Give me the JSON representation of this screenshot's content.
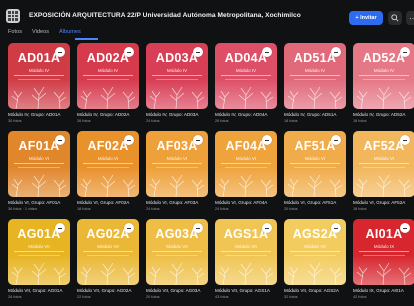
{
  "header": {
    "title": "EXPOSICIÓN ARQUITECTURA 22/P Universidad Autónoma Metropolitana, Xochimilco",
    "invite_label": "+ Invitar",
    "search_icon": "search-icon"
  },
  "tabs": [
    {
      "label": "Fotos"
    },
    {
      "label": "Videos"
    },
    {
      "label": "Álbumes",
      "active": true
    }
  ],
  "colors": {
    "accent": "#2d6cf0",
    "row1": [
      "#cf3c46",
      "#d63a4d",
      "#d83e55",
      "#dd4f66",
      "#e0697a",
      "#e57886"
    ],
    "row2": [
      "#e0872c",
      "#e9912b",
      "#eea03a",
      "#eea33c",
      "#f0ac4a",
      "#f2b75d"
    ],
    "row3": [
      "#e7b423",
      "#eab836",
      "#eebe46",
      "#f0c553",
      "#f3cc60",
      "#d7262d"
    ]
  },
  "albums": [
    {
      "code": "AD01A",
      "sub": "Módulo IV",
      "caption": "Módulo IV, Grupo: AD01A",
      "meta": "30 fotos"
    },
    {
      "code": "AD02A",
      "sub": "Módulo IV",
      "caption": "Módulo IV, Grupo: AD02A",
      "meta": "26 fotos"
    },
    {
      "code": "AD03A",
      "sub": "Módulo IV",
      "caption": "Módulo IV, Grupo: AD03A",
      "meta": "24 fotos"
    },
    {
      "code": "AD04A",
      "sub": "Módulo IV",
      "caption": "Módulo IV, Grupo: AD04A",
      "meta": "26 fotos"
    },
    {
      "code": "AD51A",
      "sub": "Módulo IV",
      "caption": "Módulo IV, Grupo: AD51A",
      "meta": "18 fotos"
    },
    {
      "code": "AD52A",
      "sub": "Módulo IV",
      "caption": "Módulo IV, Grupo: AD52A",
      "meta": "18 fotos"
    },
    {
      "code": "AF01A",
      "sub": "Módulo VI",
      "caption": "Módulo VI, Grupo: AF01A",
      "meta": "36 fotos · 1 video"
    },
    {
      "code": "AF02A",
      "sub": "Módulo VI",
      "caption": "Módulo VI, Grupo: AF02A",
      "meta": "18 fotos"
    },
    {
      "code": "AF03A",
      "sub": "Módulo VI",
      "caption": "Módulo VI, Grupo: AF03A",
      "meta": "24 fotos"
    },
    {
      "code": "AF04A",
      "sub": "Módulo VI",
      "caption": "Módulo VI, Grupo: AF04A",
      "meta": "24 fotos"
    },
    {
      "code": "AF51A",
      "sub": "Módulo VI",
      "caption": "Módulo VI, Grupo: AF51A",
      "meta": "20 fotos"
    },
    {
      "code": "AF52A",
      "sub": "Módulo VI",
      "caption": "Módulo VI, Grupo: AF52A",
      "meta": "18 fotos"
    },
    {
      "code": "AG01A",
      "sub": "Módulo VII",
      "caption": "Módulo VII, Grupo: AG01A",
      "meta": "26 fotos"
    },
    {
      "code": "AG02A",
      "sub": "Módulo VII",
      "caption": "Módulo VII, Grupo: AG02A",
      "meta": "22 fotos"
    },
    {
      "code": "AG03A",
      "sub": "Módulo VII",
      "caption": "Módulo VII, Grupo: AG03A",
      "meta": "20 fotos"
    },
    {
      "code": "AGS1A",
      "sub": "Módulo VII",
      "caption": "Módulo VII, Grupo: AGS1A",
      "meta": "43 fotos"
    },
    {
      "code": "AGS2A",
      "sub": "Módulo VII",
      "caption": "Módulo VII, Grupo: AGS2A",
      "meta": "32 fotos"
    },
    {
      "code": "AI01A",
      "sub": "Módulo IX",
      "caption": "Módulo IX, Grupo: AI01A",
      "meta": "42 fotos"
    }
  ]
}
